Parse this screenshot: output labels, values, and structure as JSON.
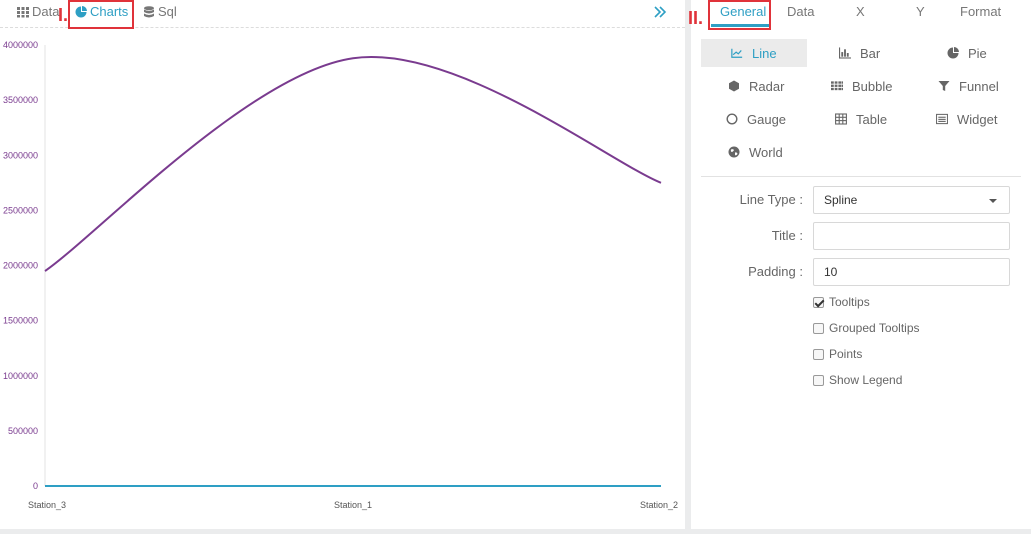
{
  "left_tabs": [
    {
      "label": "Data",
      "icon": "grid-icon"
    },
    {
      "label": "Charts",
      "icon": "pie-icon"
    },
    {
      "label": "Sql",
      "icon": "database-icon"
    }
  ],
  "annotations": {
    "left": "I.",
    "right": "II."
  },
  "right_tabs": [
    "General",
    "Data",
    "X",
    "Y",
    "Format"
  ],
  "chart_types": [
    {
      "label": "Line",
      "icon": "line-chart-icon",
      "selected": true
    },
    {
      "label": "Bar",
      "icon": "bar-chart-icon"
    },
    {
      "label": "Pie",
      "icon": "pie-chart-icon"
    },
    {
      "label": "Radar",
      "icon": "radar-icon"
    },
    {
      "label": "Bubble",
      "icon": "bubble-icon"
    },
    {
      "label": "Funnel",
      "icon": "funnel-icon"
    },
    {
      "label": "Gauge",
      "icon": "gauge-icon"
    },
    {
      "label": "Table",
      "icon": "table-icon"
    },
    {
      "label": "Widget",
      "icon": "widget-icon"
    },
    {
      "label": "World",
      "icon": "globe-icon"
    }
  ],
  "form": {
    "line_type_label": "Line Type :",
    "line_type_value": "Spline",
    "title_label": "Title :",
    "title_value": "",
    "padding_label": "Padding :",
    "padding_value": "10"
  },
  "checkboxes": [
    {
      "label": "Tooltips",
      "checked": true
    },
    {
      "label": "Grouped Tooltips",
      "checked": false
    },
    {
      "label": "Points",
      "checked": false
    },
    {
      "label": "Show Legend",
      "checked": false
    }
  ],
  "colors": {
    "accent": "#2e9fc4",
    "series_1": "#7a3b8f",
    "series_2": "#2e9fc4",
    "annotation": "#e0333a"
  },
  "chart_data": {
    "type": "line",
    "curve": "spline",
    "categories": [
      "Station_3",
      "Station_1",
      "Station_2"
    ],
    "series": [
      {
        "values": [
          1950000,
          3880000,
          2750000
        ]
      },
      {
        "values": [
          0,
          0,
          0
        ]
      }
    ],
    "yticks": [
      "0",
      "500000",
      "1000000",
      "1500000",
      "2000000",
      "2500000",
      "3000000",
      "3500000",
      "4000000"
    ],
    "ylim": [
      0,
      4000000
    ],
    "legend": "none",
    "grid": false
  }
}
